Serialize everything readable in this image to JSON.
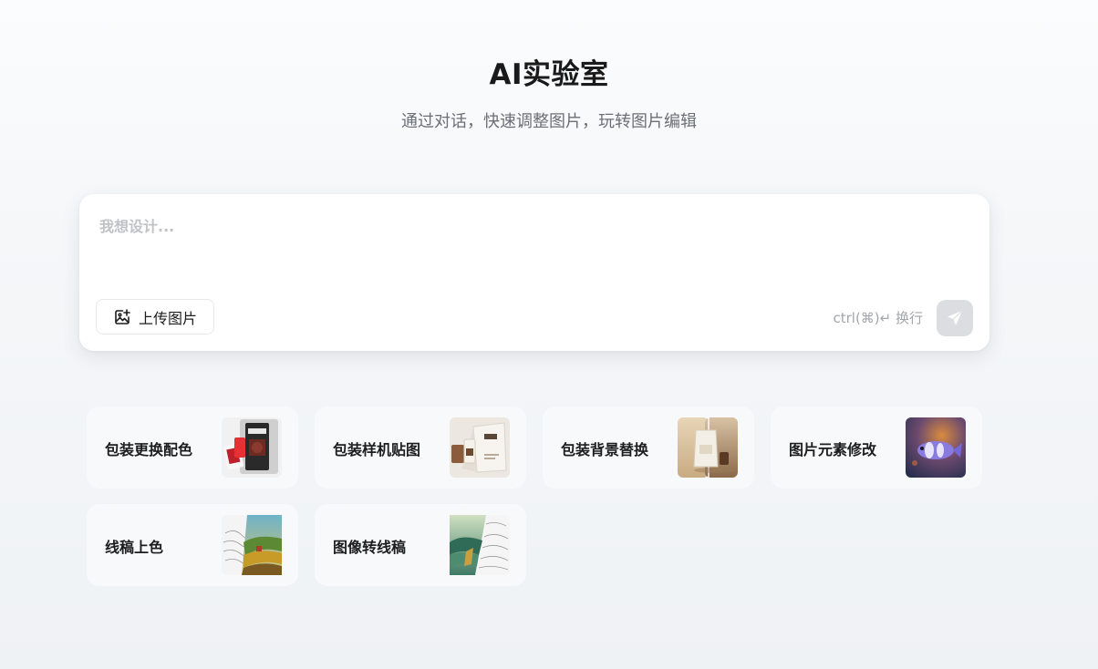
{
  "header": {
    "title": "AI实验室",
    "subtitle": "通过对话，快速调整图片，玩转图片编辑"
  },
  "prompt": {
    "placeholder": "我想设计...",
    "value": "",
    "upload_label": "上传图片",
    "shortcut_hint": "ctrl(⌘)↵ 换行"
  },
  "features": [
    {
      "label": "包装更换配色",
      "icon": "packaging-recolor-thumbnail"
    },
    {
      "label": "包装样机贴图",
      "icon": "packaging-mockup-thumbnail"
    },
    {
      "label": "包装背景替换",
      "icon": "background-replace-thumbnail"
    },
    {
      "label": "图片元素修改",
      "icon": "element-edit-thumbnail"
    },
    {
      "label": "线稿上色",
      "icon": "lineart-coloring-thumbnail"
    },
    {
      "label": "图像转线稿",
      "icon": "image-to-lineart-thumbnail"
    }
  ],
  "colors": {
    "send_button_disabled": "#dcdde0",
    "card_background": "#f8f9fa",
    "title_text": "#1a1a1a"
  }
}
